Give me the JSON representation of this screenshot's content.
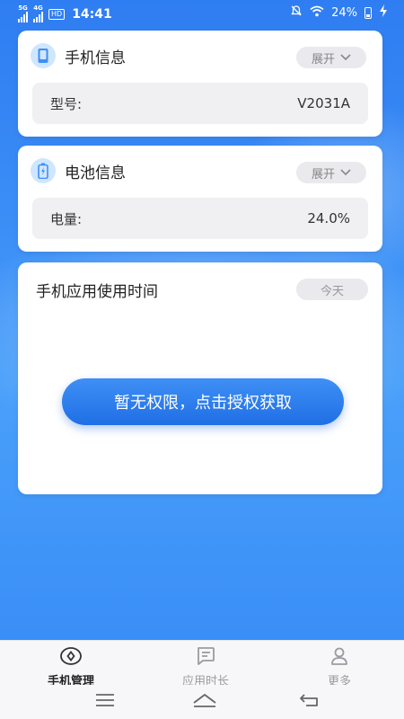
{
  "status_bar": {
    "network_1": "5G",
    "network_2": "4G",
    "hd": "HD",
    "time": "14:41",
    "battery": "24%"
  },
  "phone_info": {
    "title": "手机信息",
    "toggle_label": "展开",
    "model_label": "型号:",
    "model_value": "V2031A"
  },
  "battery_info": {
    "title": "电池信息",
    "toggle_label": "展开",
    "level_label": "电量:",
    "level_value": "24.0%"
  },
  "app_usage": {
    "title": "手机应用使用时间",
    "range_label": "今天",
    "auth_button": "暂无权限，点击授权获取"
  },
  "bottom_nav": {
    "items": [
      {
        "label": "手机管理",
        "icon": "phone-manage-icon",
        "active": true
      },
      {
        "label": "应用时长",
        "icon": "app-duration-icon",
        "active": false
      },
      {
        "label": "更多",
        "icon": "more-user-icon",
        "active": false
      }
    ]
  },
  "colors": {
    "accent": "#2f7df2",
    "button": "#1f6fe6"
  }
}
